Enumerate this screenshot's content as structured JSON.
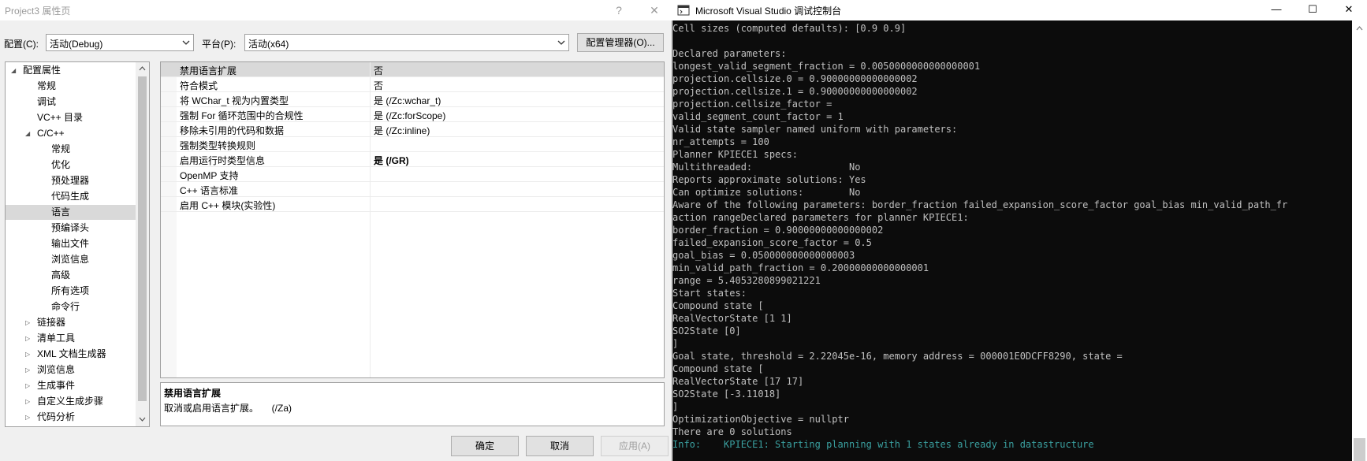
{
  "dialog": {
    "title": "Project3 属性页",
    "help_glyph": "?",
    "close_glyph": "✕",
    "config_label": "配置(C):",
    "config_value": "活动(Debug)",
    "platform_label": "平台(P):",
    "platform_value": "活动(x64)",
    "config_manager_label": "配置管理器(O)...",
    "ok_label": "确定",
    "cancel_label": "取消",
    "apply_label": "应用(A)"
  },
  "tree": {
    "items": [
      {
        "label": "配置属性",
        "tri": "◢"
      },
      {
        "label": "常规",
        "tri": ""
      },
      {
        "label": "调试",
        "tri": ""
      },
      {
        "label": "VC++ 目录",
        "tri": ""
      },
      {
        "label": "C/C++",
        "tri": "◢"
      },
      {
        "label": "常规",
        "tri": ""
      },
      {
        "label": "优化",
        "tri": ""
      },
      {
        "label": "预处理器",
        "tri": ""
      },
      {
        "label": "代码生成",
        "tri": ""
      },
      {
        "label": "语言",
        "tri": ""
      },
      {
        "label": "预编译头",
        "tri": ""
      },
      {
        "label": "输出文件",
        "tri": ""
      },
      {
        "label": "浏览信息",
        "tri": ""
      },
      {
        "label": "高级",
        "tri": ""
      },
      {
        "label": "所有选项",
        "tri": ""
      },
      {
        "label": "命令行",
        "tri": ""
      },
      {
        "label": "链接器",
        "tri": "▷"
      },
      {
        "label": "清单工具",
        "tri": "▷"
      },
      {
        "label": "XML 文档生成器",
        "tri": "▷"
      },
      {
        "label": "浏览信息",
        "tri": "▷"
      },
      {
        "label": "生成事件",
        "tri": "▷"
      },
      {
        "label": "自定义生成步骤",
        "tri": "▷"
      },
      {
        "label": "代码分析",
        "tri": "▷"
      }
    ],
    "selected_index": 9
  },
  "properties": [
    {
      "name": "禁用语言扩展",
      "value": "否",
      "bold": false
    },
    {
      "name": "符合模式",
      "value": "否",
      "bold": false
    },
    {
      "name": "将 WChar_t 视为内置类型",
      "value": "是 (/Zc:wchar_t)",
      "bold": false
    },
    {
      "name": "强制 For 循环范围中的合规性",
      "value": "是 (/Zc:forScope)",
      "bold": false
    },
    {
      "name": "移除未引用的代码和数据",
      "value": "是 (/Zc:inline)",
      "bold": false
    },
    {
      "name": "强制类型转换规则",
      "value": "",
      "bold": false
    },
    {
      "name": "启用运行时类型信息",
      "value": "是 (/GR)",
      "bold": true
    },
    {
      "name": "OpenMP 支持",
      "value": "",
      "bold": false
    },
    {
      "name": "C++ 语言标准",
      "value": "",
      "bold": false
    },
    {
      "name": "启用 C++ 模块(实验性)",
      "value": "",
      "bold": false
    }
  ],
  "description": {
    "title": "禁用语言扩展",
    "text": "取消或启用语言扩展。     (/Za)"
  },
  "console": {
    "title": "Microsoft Visual Studio 调试控制台",
    "minimize_glyph": "—",
    "maximize_glyph": "☐",
    "close_glyph": "✕",
    "lines": [
      "Cell sizes (computed defaults): [0.9 0.9]",
      "",
      "Declared parameters:",
      "longest_valid_segment_fraction = 0.0050000000000000001",
      "projection.cellsize.0 = 0.90000000000000002",
      "projection.cellsize.1 = 0.90000000000000002",
      "projection.cellsize_factor =",
      "valid_segment_count_factor = 1",
      "Valid state sampler named uniform with parameters:",
      "nr_attempts = 100",
      "Planner KPIECE1 specs:",
      "Multithreaded:                 No",
      "Reports approximate solutions: Yes",
      "Can optimize solutions:        No",
      "Aware of the following parameters: border_fraction failed_expansion_score_factor goal_bias min_valid_path_fr",
      "action rangeDeclared parameters for planner KPIECE1:",
      "border_fraction = 0.90000000000000002",
      "failed_expansion_score_factor = 0.5",
      "goal_bias = 0.050000000000000003",
      "min_valid_path_fraction = 0.20000000000000001",
      "range = 5.4053280899021221",
      "Start states:",
      "Compound state [",
      "RealVectorState [1 1]",
      "SO2State [0]",
      "]",
      "Goal state, threshold = 2.22045e-16, memory address = 000001E0DCFF8290, state =",
      "Compound state [",
      "RealVectorState [17 17]",
      "SO2State [-3.11018]",
      "]",
      "OptimizationObjective = nullptr",
      "There are 0 solutions"
    ],
    "info_line": "Info:    KPIECE1: Starting planning with 1 states already in datastructure"
  }
}
